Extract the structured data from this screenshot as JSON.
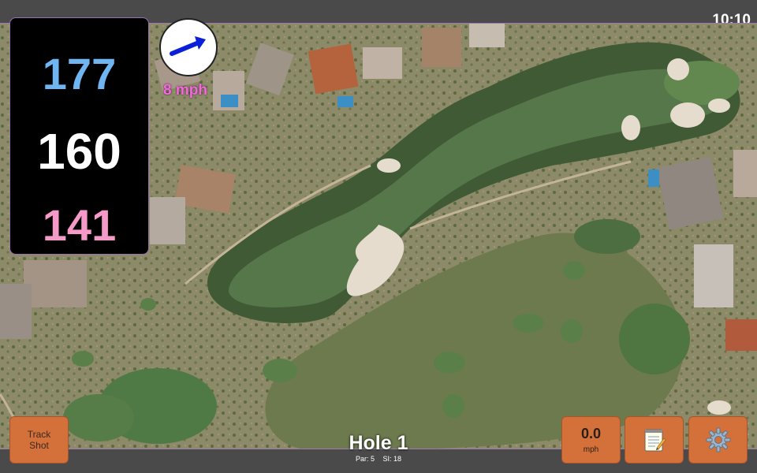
{
  "status": {
    "time": "10:10"
  },
  "distances": {
    "back": "177",
    "middle": "160",
    "front": "141"
  },
  "wind": {
    "speed_label": "8 mph",
    "direction_icon": "arrow-icon"
  },
  "hole": {
    "title": "Hole 1",
    "par": "Par: 5",
    "si": "SI: 18"
  },
  "buttons": {
    "track_shot": "Track\nShot",
    "wind_value": "0.0",
    "wind_unit": "mph",
    "notes_icon": "notepad-icon",
    "settings_icon": "gear-icon"
  },
  "colors": {
    "back_distance": "#6fb5f2",
    "middle_distance": "#ffffff",
    "front_distance": "#f59ac8",
    "wind_text": "#f06ad9",
    "button_bg": "#d4703a"
  }
}
